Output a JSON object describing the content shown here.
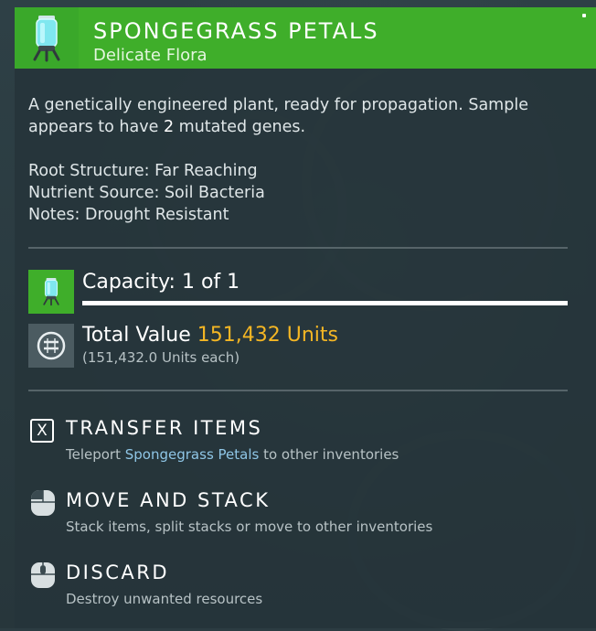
{
  "item": {
    "name": "SPONGEGRASS PETALS",
    "category": "Delicate Flora",
    "description_before": "A genetically engineered plant, ready for propagation. Sample appears to have ",
    "mutated_genes": "2",
    "description_after": " mutated genes.",
    "properties": [
      "Root Structure: Far Reaching",
      "Nutrient Source: Soil Bacteria",
      "Notes: Drought Resistant"
    ],
    "icon": "glass-capsule-plant-icon"
  },
  "capacity": {
    "label": "Capacity: 1 of 1",
    "fill_fraction": 1.0
  },
  "value": {
    "label": "Total Value",
    "amount": "151,432 Units",
    "each": "(151,432.0 Units each)",
    "icon": "units-currency-icon"
  },
  "actions": [
    {
      "key": "X",
      "title": "TRANSFER ITEMS",
      "desc_before": "Teleport ",
      "desc_highlight": "Spongegrass Petals",
      "desc_after": " to other inventories",
      "icon": "x-key-icon"
    },
    {
      "title": "MOVE AND STACK",
      "desc": "Stack items, split stacks or move to other inventories",
      "icon": "mouse-left-click-icon"
    },
    {
      "title": "DISCARD",
      "desc": "Destroy unwanted resources",
      "icon": "mouse-hold-icon"
    }
  ],
  "colors": {
    "header_green": "#3fae2a",
    "units_gold": "#f4b624",
    "highlight_blue": "#8fc6e6"
  }
}
